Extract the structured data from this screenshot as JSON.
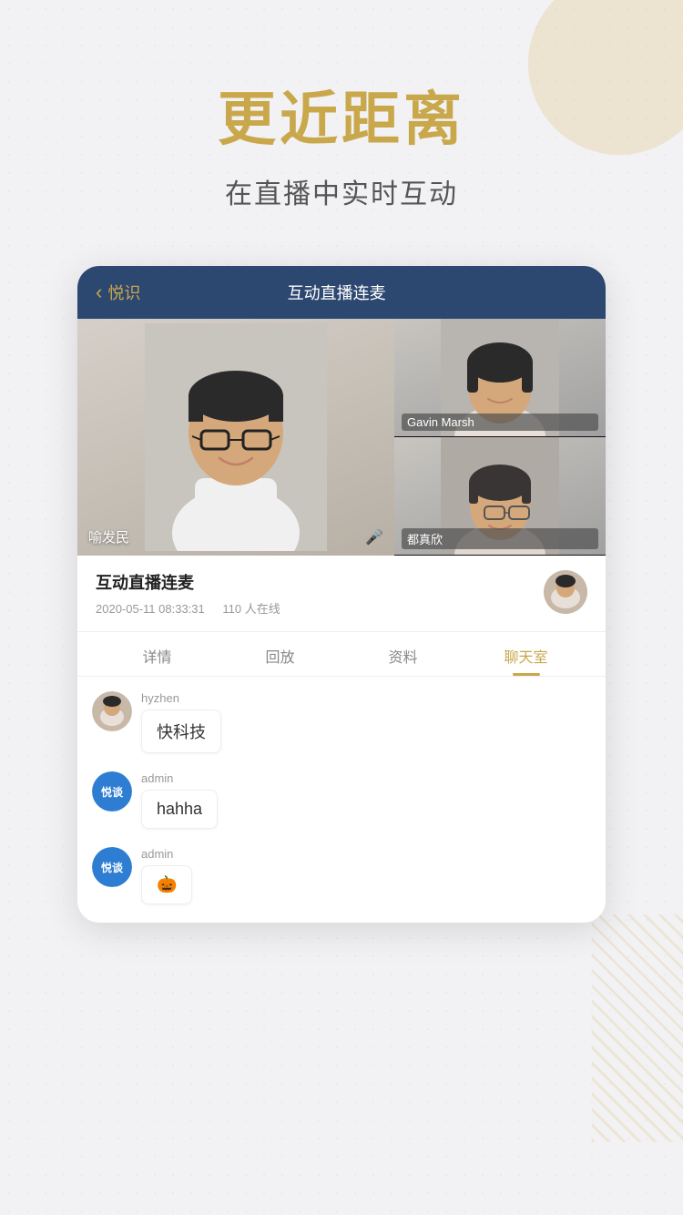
{
  "background": {
    "dot_pattern": true
  },
  "header": {
    "main_title": "更近距离",
    "sub_title": "在直播中实时互动"
  },
  "phone": {
    "nav": {
      "back_label": "悦识",
      "title": "互动直播连麦"
    },
    "video": {
      "main_presenter": {
        "name": "喻发民",
        "mic_icon": "🎤"
      },
      "side_top": {
        "name": "Gavin Marsh"
      },
      "side_bottom": {
        "name": "都真欣"
      }
    },
    "info": {
      "title": "互动直播连麦",
      "date": "2020-05-11 08:33:31",
      "online_count": "110 人在线"
    },
    "tabs": [
      {
        "label": "详情",
        "active": false
      },
      {
        "label": "回放",
        "active": false
      },
      {
        "label": "资料",
        "active": false
      },
      {
        "label": "聊天室",
        "active": true
      }
    ],
    "chat": {
      "messages": [
        {
          "id": 1,
          "username": "hyzhen",
          "avatar_type": "photo",
          "text": "快科技"
        },
        {
          "id": 2,
          "username": "admin",
          "avatar_type": "badge",
          "badge_text": "悦谈",
          "text": "hahha"
        },
        {
          "id": 3,
          "username": "admin",
          "avatar_type": "badge",
          "badge_text": "悦谈",
          "text": "🎃"
        }
      ]
    }
  }
}
